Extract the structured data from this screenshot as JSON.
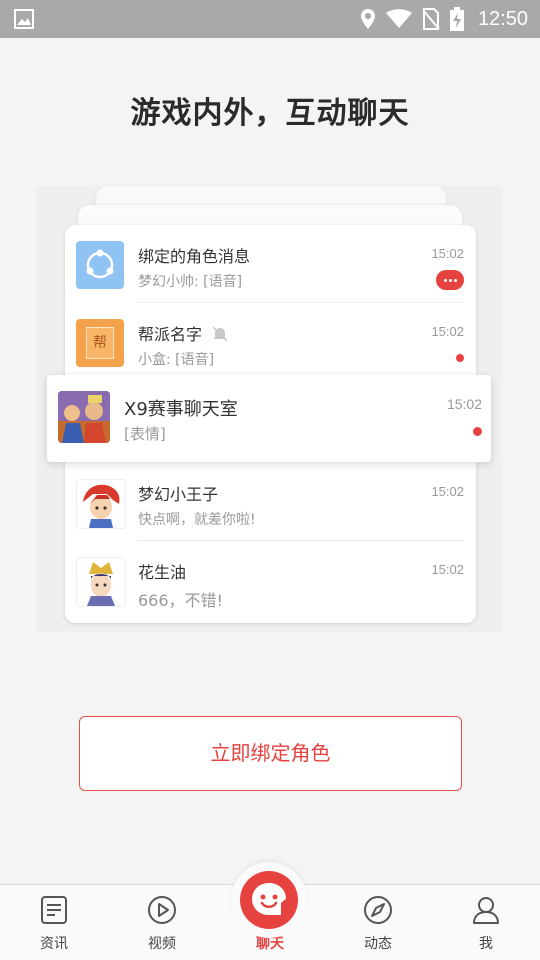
{
  "status_bar": {
    "time": "12:50"
  },
  "headline": "游戏内外，互动聊天",
  "conversations": [
    {
      "name": "绑定的角色消息",
      "preview": "梦幻小帅: [语音]",
      "time": "15:02",
      "indicator": "more"
    },
    {
      "name": "帮派名字",
      "preview": "小盒: [语音]",
      "time": "15:02",
      "indicator": "dot",
      "avatar_glyph": "帮",
      "muted": true
    },
    {
      "name": "X9赛事聊天室",
      "preview": "[表情]",
      "time": "15:02",
      "indicator": "dot"
    },
    {
      "name": "梦幻小王子",
      "preview": "快点啊，就差你啦!",
      "time": "15:02"
    },
    {
      "name": "花生油",
      "preview": "666，不错!",
      "time": "15:02"
    }
  ],
  "bind_button": "立即绑定角色",
  "tabs": [
    {
      "label": "资讯",
      "icon": "news-icon"
    },
    {
      "label": "视频",
      "icon": "video-icon"
    },
    {
      "label": "聊天",
      "icon": "chat-icon",
      "active": true
    },
    {
      "label": "动态",
      "icon": "compass-icon"
    },
    {
      "label": "我",
      "icon": "profile-icon"
    }
  ],
  "colors": {
    "accent": "#e64340",
    "status_bar": "#a9a9a9",
    "background": "#f4f4f4"
  }
}
